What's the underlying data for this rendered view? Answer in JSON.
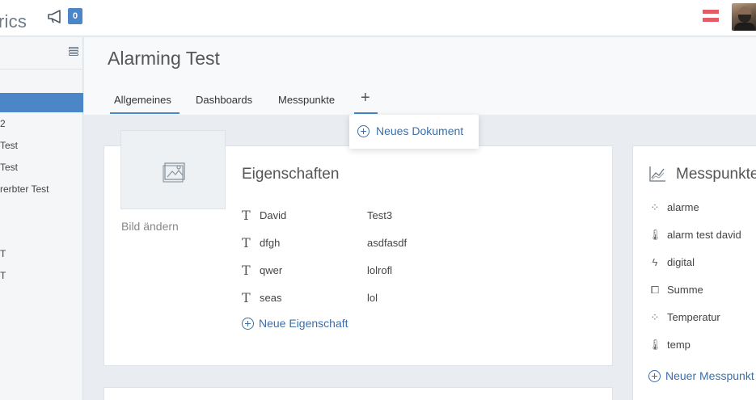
{
  "app": {
    "logo_partial": "rics",
    "notifications_count": "0"
  },
  "sidebar": {
    "items": [
      {
        "label": "",
        "active": true
      },
      {
        "label": "2",
        "active": false
      },
      {
        "label": " Test",
        "active": false
      },
      {
        "label": "Test",
        "active": false
      },
      {
        "label": "rerbter Test",
        "active": false
      },
      {
        "label": "T",
        "active": false
      },
      {
        "label": "T",
        "active": false
      }
    ]
  },
  "page": {
    "title": "Alarming Test"
  },
  "tabs": [
    {
      "label": "Allgemeines",
      "active": true
    },
    {
      "label": "Dashboards",
      "active": false
    },
    {
      "label": "Messpunkte",
      "active": false
    }
  ],
  "tab_add_label": "+",
  "dropdown": {
    "new_document": "Neues Dokument"
  },
  "image": {
    "change_label": "Bild ändern"
  },
  "properties": {
    "title": "Eigenschaften",
    "rows": [
      {
        "key": "David",
        "value": "Test3"
      },
      {
        "key": "dfgh",
        "value": "asdfasdf"
      },
      {
        "key": "qwer",
        "value": "lolrofl"
      },
      {
        "key": "seas",
        "value": "lol"
      }
    ],
    "add_label": "Neue Eigenschaft"
  },
  "messpunkte": {
    "title": "Messpunkte",
    "items": [
      {
        "label": "alarme",
        "icon": "spinner-icon"
      },
      {
        "label": "alarm test david",
        "icon": "thermometer-icon"
      },
      {
        "label": "digital",
        "icon": "bolt-icon"
      },
      {
        "label": "Summe",
        "icon": "vector-square-icon"
      },
      {
        "label": "Temperatur",
        "icon": "spinner-icon"
      },
      {
        "label": "temp",
        "icon": "thermometer-icon"
      }
    ],
    "add_label": "Neuer Messpunkt"
  },
  "colors": {
    "accent": "#4a86c8",
    "link": "#3b6fa8",
    "flag_red": "#e35c66"
  }
}
